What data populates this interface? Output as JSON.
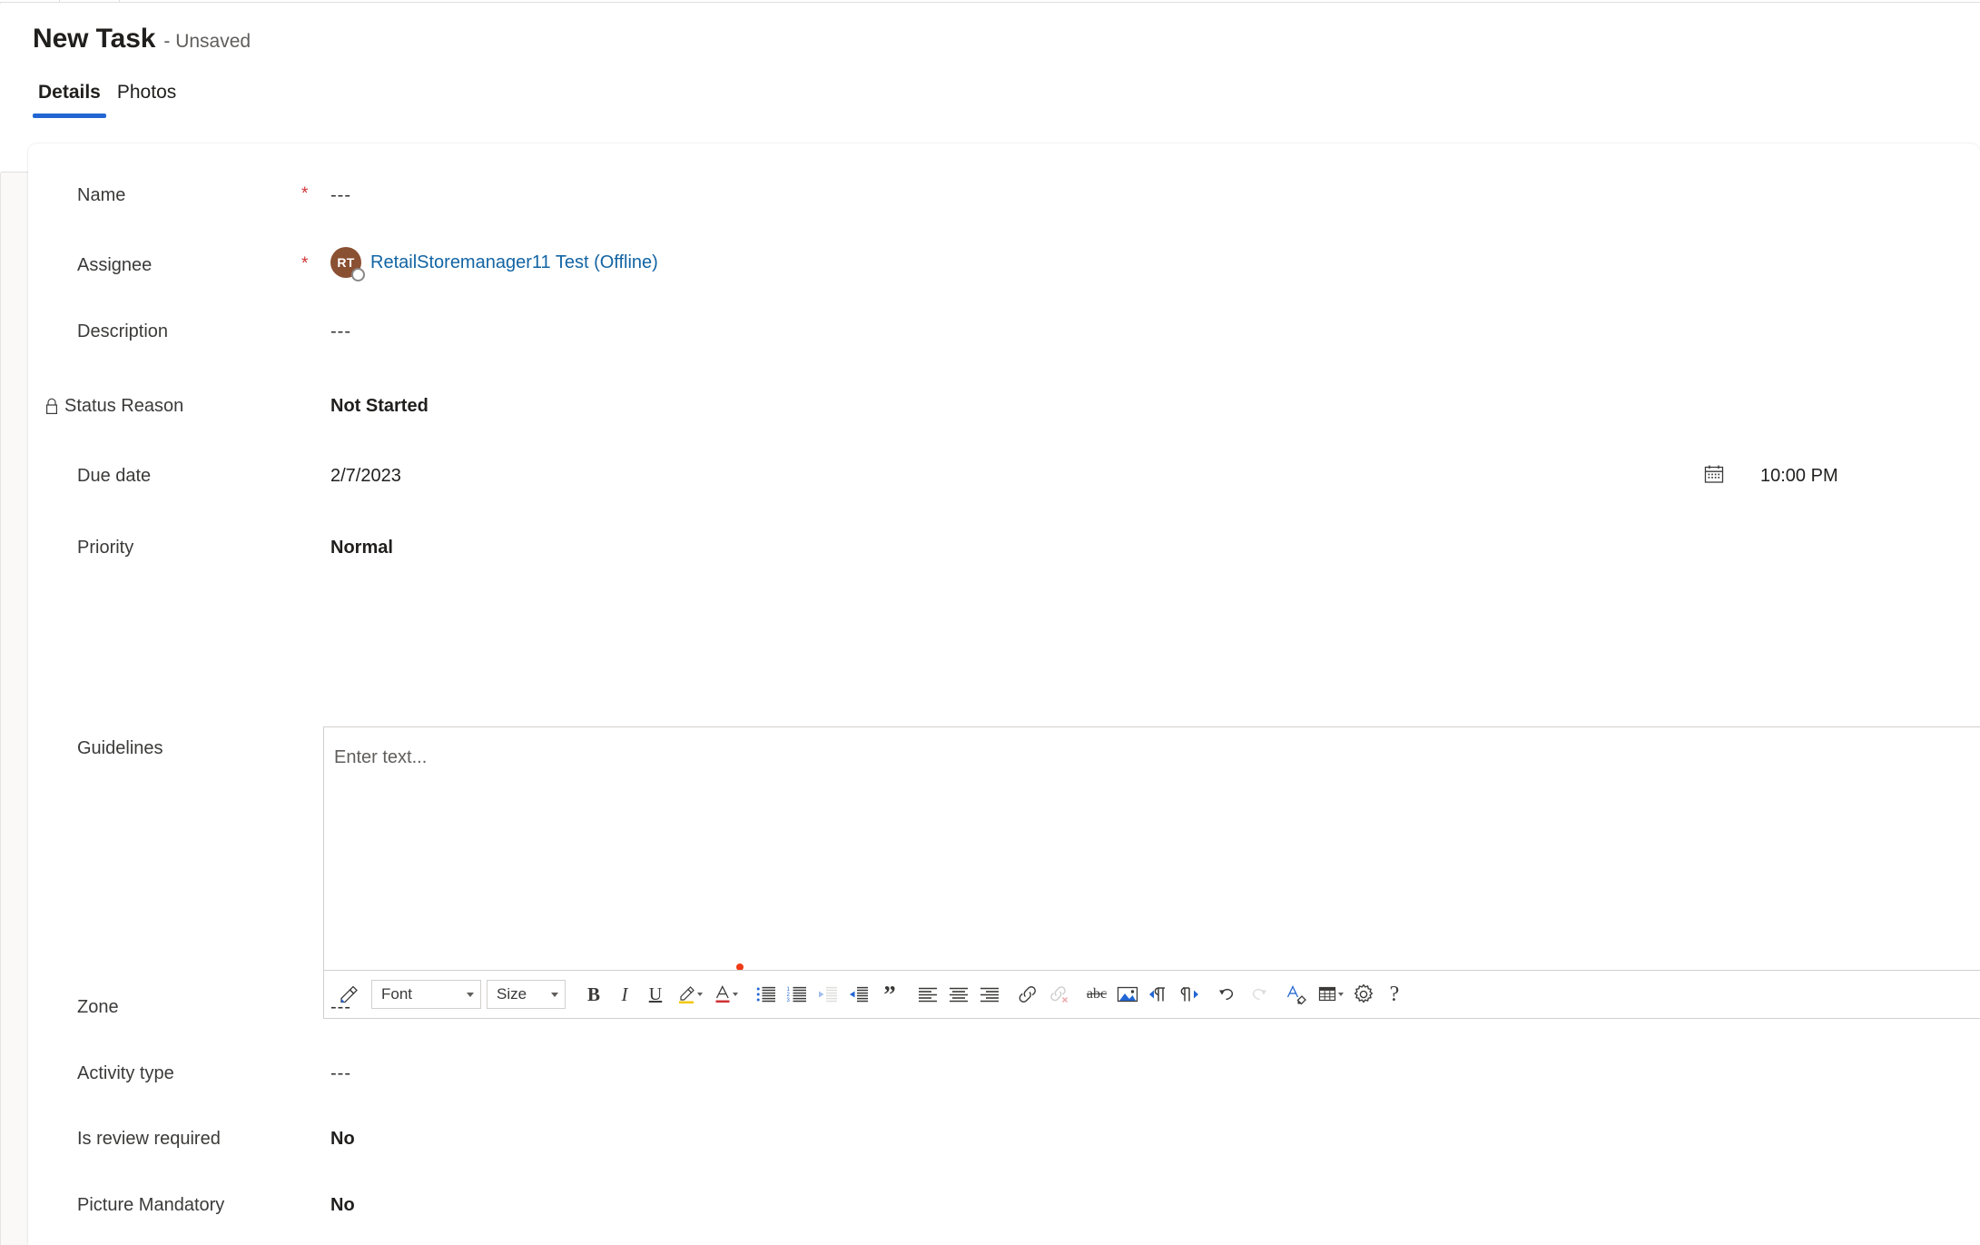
{
  "header": {
    "title": "New Task",
    "unsaved": "- Unsaved"
  },
  "tabs": [
    {
      "label": "Details",
      "active": true
    },
    {
      "label": "Photos",
      "active": false
    }
  ],
  "fields": {
    "name": {
      "label": "Name",
      "required": "*",
      "value": "---"
    },
    "assignee": {
      "label": "Assignee",
      "required": "*",
      "avatar_initials": "RT",
      "value": "RetailStoremanager11 Test (Offline)",
      "avatar_color": "#8a5032",
      "link_color": "#1264a3",
      "presence": "offline"
    },
    "description": {
      "label": "Description",
      "value": "---"
    },
    "status_reason": {
      "label": "Status Reason",
      "value": "Not Started",
      "locked": true
    },
    "due_date": {
      "label": "Due date",
      "value": "2/7/2023",
      "time": "10:00 PM"
    },
    "priority": {
      "label": "Priority",
      "value": "Normal"
    },
    "guidelines": {
      "label": "Guidelines",
      "placeholder": "Enter text..."
    },
    "zone": {
      "label": "Zone",
      "value": "---"
    },
    "activity_type": {
      "label": "Activity type",
      "value": "---"
    },
    "is_review_required": {
      "label": "Is review required",
      "value": "No"
    },
    "picture_mandatory": {
      "label": "Picture Mandatory",
      "value": "No"
    }
  },
  "editor_toolbar": {
    "format_painter": "format-painter",
    "font": {
      "label": "Font"
    },
    "size": {
      "label": "Size"
    },
    "bold": "B",
    "italic": "I",
    "underline": "U",
    "highlight": "highlight",
    "font_color": "A",
    "bullet_list": "bulleted-list",
    "numbered_list": "numbered-list",
    "decrease_indent": "decrease-indent",
    "increase_indent": "increase-indent",
    "blockquote": "”",
    "align_left": "align-left",
    "align_center": "align-center",
    "align_right": "align-right",
    "insert_link": "insert-link",
    "remove_link": "remove-link",
    "strikethrough": "abc",
    "insert_image": "insert-image",
    "ltr": "left-to-right",
    "rtl": "right-to-left",
    "undo": "undo",
    "redo": "redo",
    "clear_format": "clear-formatting",
    "table": "table",
    "settings": "settings",
    "help": "?"
  },
  "colors": {
    "accent": "#2266d3",
    "required": "#d13438",
    "link": "#1264a3",
    "avatar": "#8a5032",
    "highlight": "#f2c811",
    "red_dot": "#f03a17",
    "border": "#d2d0ce",
    "page_bg": "#faf9f8"
  }
}
